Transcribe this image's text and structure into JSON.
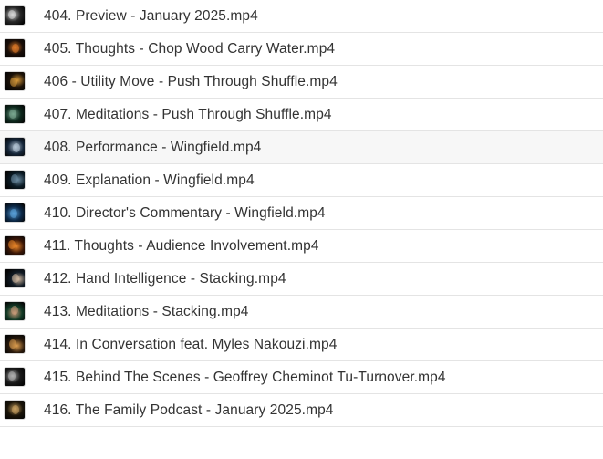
{
  "files": [
    {
      "name": "404. Preview - January 2025.mp4",
      "thumbnail": "video-thumbnail-icon",
      "thumb_colors": [
        "#2a2a2a",
        "#d8d8d8"
      ]
    },
    {
      "name": "405. Thoughts - Chop Wood Carry Water.mp4",
      "thumbnail": "video-thumbnail-icon",
      "thumb_colors": [
        "#1a0e08",
        "#e07a28"
      ]
    },
    {
      "name": "406 - Utility Move - Push Through Shuffle.mp4",
      "thumbnail": "video-thumbnail-icon",
      "thumb_colors": [
        "#1c1208",
        "#d89a3a"
      ]
    },
    {
      "name": "407. Meditations - Push Through Shuffle.mp4",
      "thumbnail": "video-thumbnail-icon",
      "thumb_colors": [
        "#0e2a1e",
        "#7aa890"
      ]
    },
    {
      "name": "408. Performance - Wingfield.mp4",
      "thumbnail": "video-thumbnail-icon",
      "thumb_colors": [
        "#15263a",
        "#b8c8d8"
      ]
    },
    {
      "name": "409. Explanation - Wingfield.mp4",
      "thumbnail": "video-thumbnail-icon",
      "thumb_colors": [
        "#0a1a24",
        "#6a8aa0"
      ]
    },
    {
      "name": "410. Director's Commentary - Wingfield.mp4",
      "thumbnail": "video-thumbnail-icon",
      "thumb_colors": [
        "#0c2a4a",
        "#5aa0d8"
      ]
    },
    {
      "name": "411. Thoughts - Audience Involvement.mp4",
      "thumbnail": "video-thumbnail-icon",
      "thumb_colors": [
        "#3a1606",
        "#f08a2a"
      ]
    },
    {
      "name": "412. Hand Intelligence - Stacking.mp4",
      "thumbnail": "video-thumbnail-icon",
      "thumb_colors": [
        "#101a24",
        "#d0b8a0"
      ]
    },
    {
      "name": "413. Meditations - Stacking.mp4",
      "thumbnail": "video-thumbnail-icon",
      "thumb_colors": [
        "#123a26",
        "#c89a78"
      ]
    },
    {
      "name": "414. In Conversation feat. Myles Nakouzi.mp4",
      "thumbnail": "video-thumbnail-icon",
      "thumb_colors": [
        "#2a1a0c",
        "#e0a050"
      ]
    },
    {
      "name": "415. Behind The Scenes - Geoffrey Cheminot Tu-Turnover.mp4",
      "thumbnail": "video-thumbnail-icon",
      "thumb_colors": [
        "#1a1a1a",
        "#b0b0b0"
      ]
    },
    {
      "name": "416. The Family Podcast - January 2025.mp4",
      "thumbnail": "video-thumbnail-icon",
      "thumb_colors": [
        "#1a1408",
        "#c8a060"
      ]
    }
  ],
  "highlighted_index": 4
}
